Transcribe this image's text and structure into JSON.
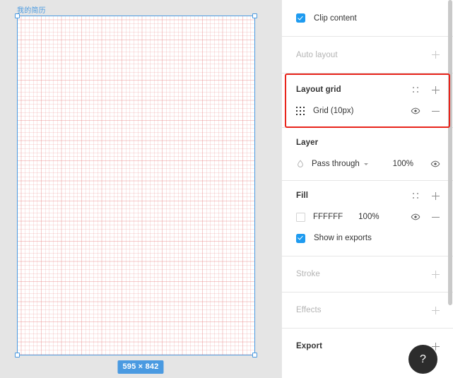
{
  "canvas": {
    "frame_label": "我的简历",
    "dimension_badge": "595 × 842",
    "frame_fill": "#FFFFFF",
    "grid_color": "#E87D7D",
    "selection_color": "#4A9AE1",
    "background": "#E5E5E5"
  },
  "panel": {
    "clip_content": {
      "label": "Clip content",
      "checked": true
    },
    "auto_layout": {
      "title": "Auto layout",
      "add_label": "+"
    },
    "layout_grid": {
      "title": "Layout grid",
      "add_label": "+",
      "items": [
        {
          "label": "Grid (10px)",
          "icon": "grid-dots-icon",
          "visible": true,
          "remove_label": "−"
        }
      ]
    },
    "layer": {
      "title": "Layer",
      "blend_mode": "Pass through",
      "opacity": "100%"
    },
    "fill": {
      "title": "Fill",
      "add_label": "+",
      "items": [
        {
          "hex": "FFFFFF",
          "opacity": "100%",
          "swatch_color": "#FFFFFF",
          "remove_label": "−"
        }
      ],
      "show_in_exports": {
        "label": "Show in exports",
        "checked": true
      }
    },
    "stroke": {
      "title": "Stroke",
      "add_label": "+"
    },
    "effects": {
      "title": "Effects",
      "add_label": "+"
    },
    "export": {
      "title": "Export",
      "add_label": "+"
    },
    "annotation_color": "#E8241B",
    "accent_color": "#1E9BF0"
  },
  "help": {
    "label": "?"
  }
}
